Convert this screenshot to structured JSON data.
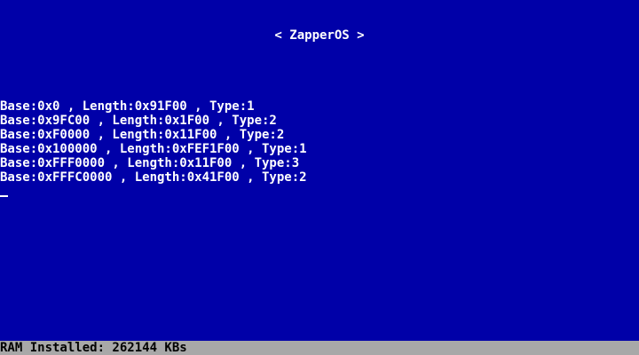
{
  "title": "< ZapperOS >",
  "memory_map": [
    "Base:0x0 , Length:0x91F00 , Type:1",
    "Base:0x9FC00 , Length:0x1F00 , Type:2",
    "Base:0xF0000 , Length:0x11F00 , Type:2",
    "Base:0x100000 , Length:0xFEF1F00 , Type:1",
    "Base:0xFFF0000 , Length:0x11F00 , Type:3",
    "Base:0xFFFC0000 , Length:0x41F00 , Type:2"
  ],
  "status_bar": {
    "text": "RAM Installed: 262144 KBs"
  },
  "colors": {
    "background": "#0000a8",
    "text": "#ffffff",
    "status_bar_bg": "#a8a8a8",
    "status_bar_text": "#000000"
  }
}
